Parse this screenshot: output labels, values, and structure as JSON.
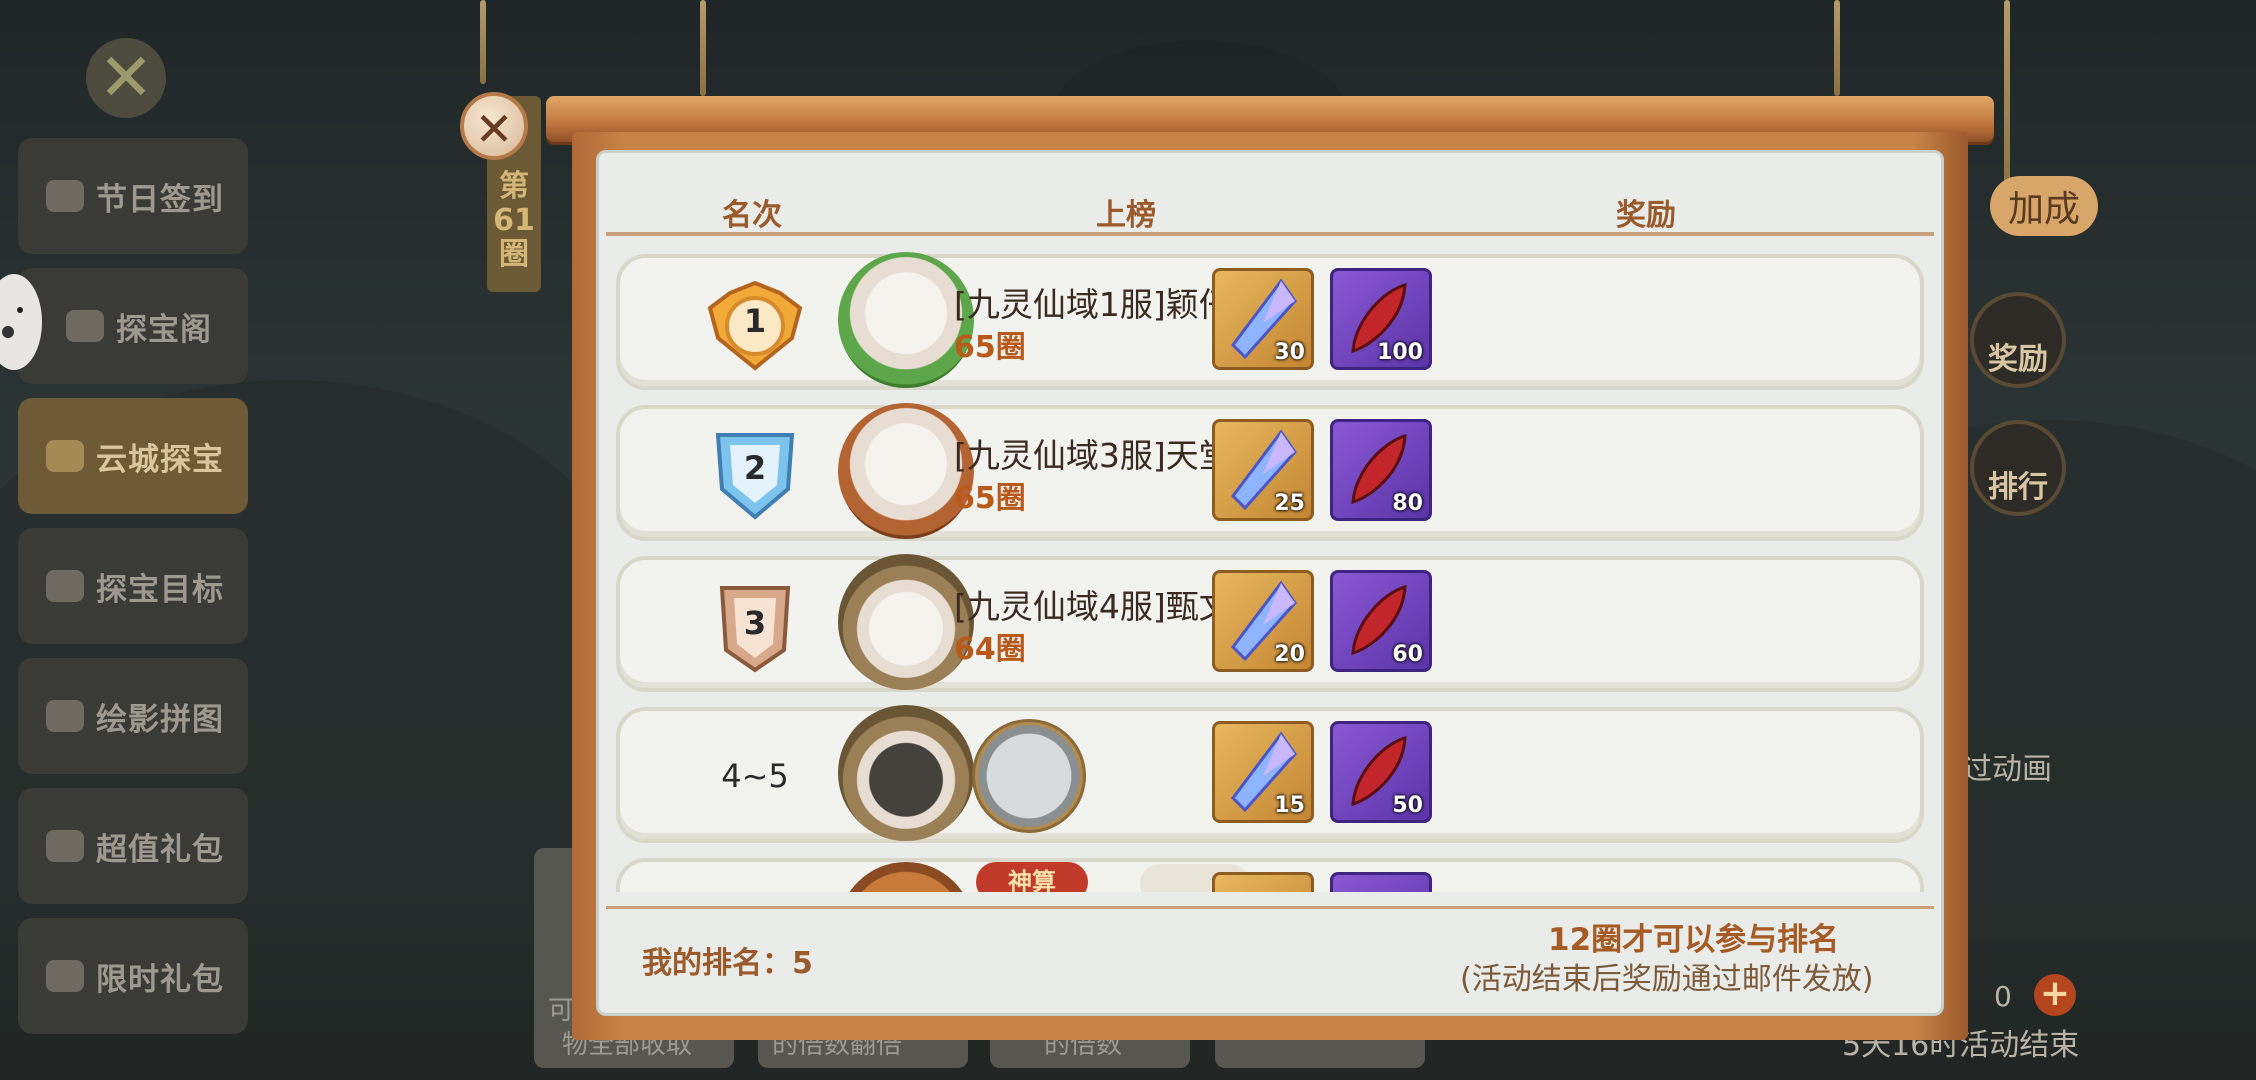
{
  "left_menu": {
    "close_glyph": "✕",
    "items": [
      {
        "label": "节日签到",
        "active": false,
        "icon": "calendar-icon"
      },
      {
        "label": "探宝阁",
        "active": false,
        "icon": "pavilion-icon"
      },
      {
        "label": "云城探宝",
        "active": true,
        "icon": "cloud-city-icon"
      },
      {
        "label": "探宝目标",
        "active": false,
        "icon": "target-icon"
      },
      {
        "label": "绘影拼图",
        "active": false,
        "icon": "puzzle-icon"
      },
      {
        "label": "超值礼包",
        "active": false,
        "icon": "gift-icon"
      },
      {
        "label": "限时礼包",
        "active": false,
        "icon": "timed-gift-icon"
      }
    ]
  },
  "round_tag": {
    "line1": "第",
    "line2": "61",
    "line3": "圈"
  },
  "right_side": {
    "bonus_label": "加成",
    "reward_button": "奖励",
    "rank_button": "排行",
    "skip_anim": "过动画",
    "counter_value": "0",
    "end_notice": "5天16时活动结束"
  },
  "bottom_buttons": {
    "b1_top": "可",
    "b1": "物全部收取",
    "b2": "的倍数翻倍",
    "b3": "的倍数"
  },
  "panel": {
    "close_glyph": "✕",
    "headers": {
      "rank": "名次",
      "list": "上榜",
      "reward": "奖励"
    },
    "rows": [
      {
        "rank": "1",
        "name": "[九灵仙域1服]颖仔",
        "score": "65圈",
        "rewards": [
          {
            "type": "blue-crystal",
            "qty": "30"
          },
          {
            "type": "red-feather",
            "qty": "100"
          }
        ]
      },
      {
        "rank": "2",
        "name": "[九灵仙域3服]天堂葵",
        "score": "65圈",
        "rewards": [
          {
            "type": "blue-crystal",
            "qty": "25"
          },
          {
            "type": "red-feather",
            "qty": "80"
          }
        ]
      },
      {
        "rank": "3",
        "name": "[九灵仙域4服]甄文君",
        "score": "64圈",
        "rewards": [
          {
            "type": "blue-crystal",
            "qty": "20"
          },
          {
            "type": "red-feather",
            "qty": "60"
          }
        ]
      },
      {
        "rank": "4~5",
        "name": "",
        "score": "",
        "rewards": [
          {
            "type": "blue-crystal",
            "qty": "15"
          },
          {
            "type": "red-feather",
            "qty": "50"
          }
        ]
      }
    ],
    "peek_badge": "神算",
    "my_rank_label": "我的排名：",
    "my_rank_value": "5",
    "requirement": "12圈才可以参与排名",
    "mail_note": "(活动结束后奖励通过邮件发放)"
  },
  "colors": {
    "frame": "#c88448",
    "board": "#e9ece9",
    "header_text": "#9a5a2c",
    "score_text": "#b85a1c"
  }
}
